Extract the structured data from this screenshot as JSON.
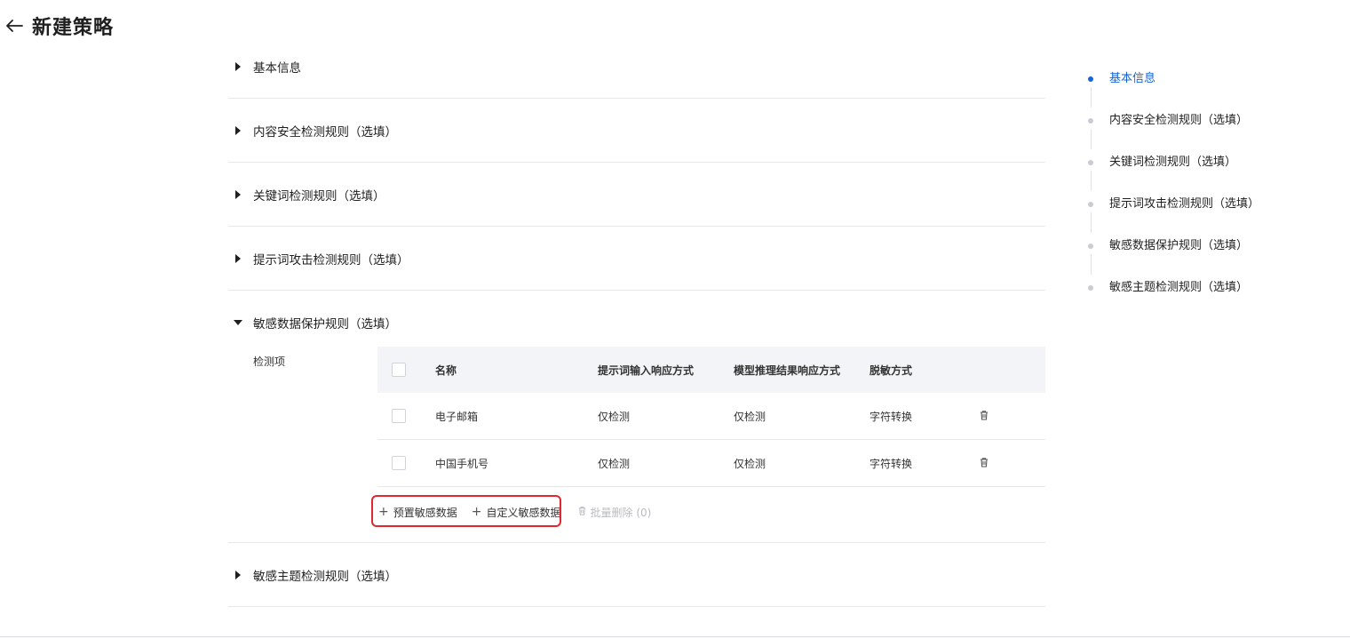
{
  "header": {
    "title": "新建策略"
  },
  "sections": [
    {
      "title": "基本信息"
    },
    {
      "title": "内容安全检测规则（选填）"
    },
    {
      "title": "关键词检测规则（选填）"
    },
    {
      "title": "提示词攻击检测规则（选填）"
    },
    {
      "title": "敏感数据保护规则（选填）"
    },
    {
      "title": "敏感主题检测规则（选填）"
    }
  ],
  "sensitive": {
    "field_label": "检测项",
    "columns": [
      "名称",
      "提示词输入响应方式",
      "模型推理结果响应方式",
      "脱敏方式"
    ],
    "rows": [
      {
        "name": "电子邮箱",
        "prompt_response": "仅检测",
        "model_response": "仅检测",
        "mask": "字符转换"
      },
      {
        "name": "中国手机号",
        "prompt_response": "仅检测",
        "model_response": "仅检测",
        "mask": "字符转换"
      }
    ],
    "actions": {
      "preset": "预置敏感数据",
      "custom": "自定义敏感数据",
      "batch_delete": "批量删除 (0)"
    }
  },
  "anchor": {
    "items": [
      {
        "label": "基本信息",
        "active": true
      },
      {
        "label": "内容安全检测规则（选填）"
      },
      {
        "label": "关键词检测规则（选填）"
      },
      {
        "label": "提示词攻击检测规则（选填）"
      },
      {
        "label": "敏感数据保护规则（选填）"
      },
      {
        "label": "敏感主题检测规则（选填）"
      }
    ]
  },
  "colors": {
    "accent": "#1664d6",
    "highlight": "#e0282e",
    "border": "#e6e8eb",
    "table_header": "#f2f4f7"
  },
  "icons": [
    "arrow-left-icon",
    "caret-right-icon",
    "caret-down-icon",
    "trash-icon",
    "plus-icon"
  ]
}
